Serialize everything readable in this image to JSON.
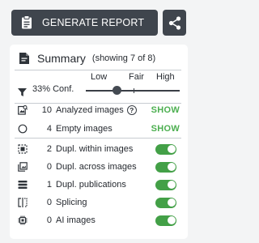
{
  "toolbar": {
    "generate_label": "GENERATE REPORT"
  },
  "summary": {
    "title": "Summary",
    "showing": "(showing 7 of 8)"
  },
  "confidence": {
    "text": "33% Conf.",
    "levels": [
      "Low",
      "Fair",
      "High"
    ],
    "value_percent": 33
  },
  "rows": [
    {
      "value": "10",
      "label": "Analyzed images",
      "action": "SHOW",
      "icon": "image-search-icon"
    },
    {
      "value": "4",
      "label": "Empty images",
      "action": "SHOW",
      "icon": "circle-icon"
    },
    {
      "value": "2",
      "label": "Dupl. within images",
      "enabled": true,
      "icon": "dashed-square-icon"
    },
    {
      "value": "0",
      "label": "Dupl. across images",
      "enabled": true,
      "icon": "image-stack-icon"
    },
    {
      "value": "1",
      "label": "Dupl. publications",
      "enabled": true,
      "icon": "stack-lines-icon"
    },
    {
      "value": "0",
      "label": "Splicing",
      "enabled": true,
      "icon": "splice-icon"
    },
    {
      "value": "0",
      "label": "AI images",
      "enabled": true,
      "icon": "chip-icon"
    }
  ],
  "colors": {
    "toggle_on": "#43a047",
    "show_link": "#4caf50",
    "button_bg": "#3f454d"
  }
}
